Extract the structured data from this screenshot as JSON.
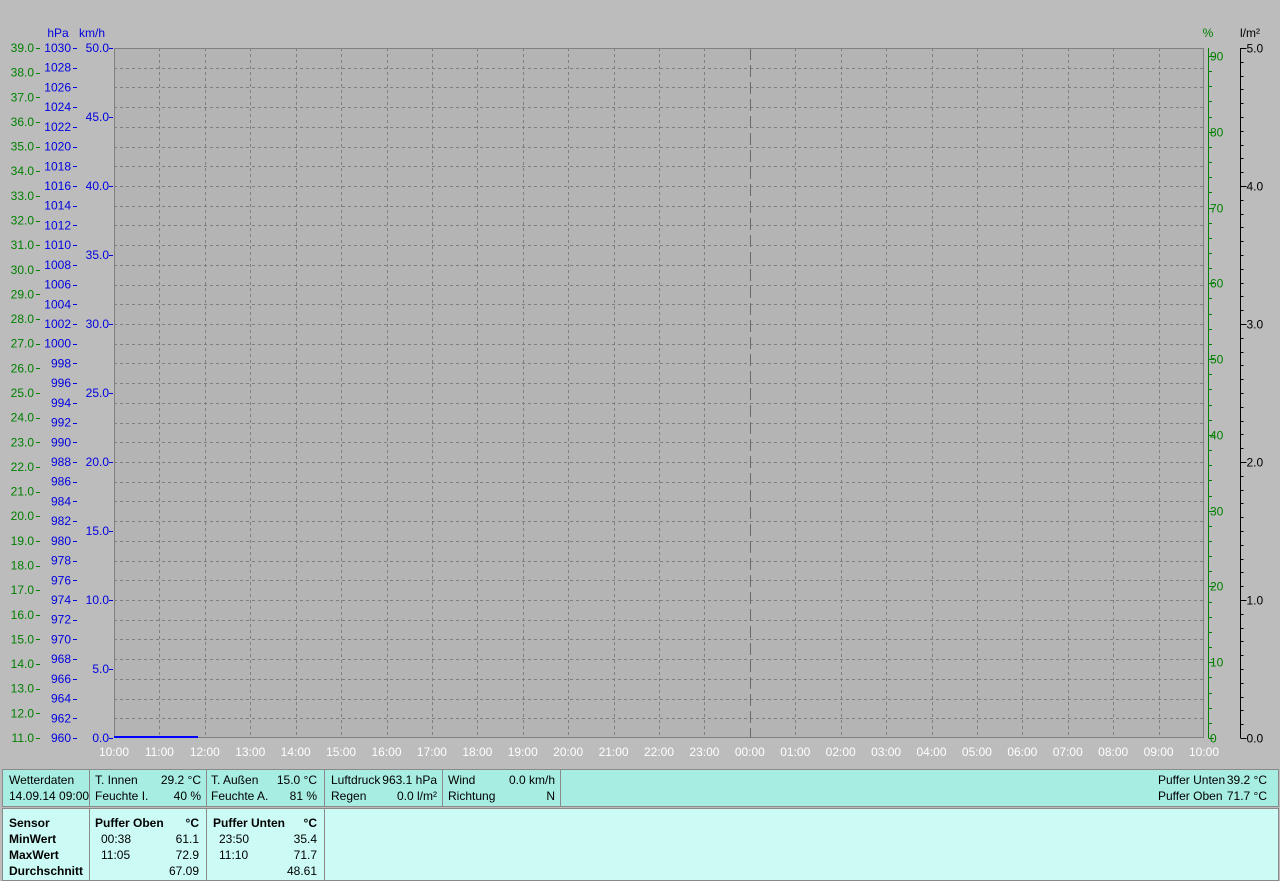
{
  "colors": {
    "background": "#bcbcbc",
    "plot_area": "#b4b4b4",
    "grid": "#7f7f7f",
    "axis_green": "#008000",
    "axis_blue": "#0000e0",
    "axis_black": "#000000",
    "status_bg": "#a8ede2",
    "table_bg": "#ccfbf6",
    "series_line": "#0000ff"
  },
  "chart_data": {
    "type": "line",
    "x_tick_labels": [
      "10:00",
      "11:00",
      "12:00",
      "13:00",
      "14:00",
      "15:00",
      "16:00",
      "17:00",
      "18:00",
      "19:00",
      "20:00",
      "21:00",
      "22:00",
      "23:00",
      "00:00",
      "01:00",
      "02:00",
      "03:00",
      "04:00",
      "05:00",
      "06:00",
      "07:00",
      "08:00",
      "09:00",
      "10:00"
    ],
    "midnight_tick_index": 14,
    "axes": {
      "temp": {
        "range": [
          11.0,
          39.0
        ],
        "step": 1.0,
        "color": "#008000",
        "label": ""
      },
      "pressure": {
        "range": [
          960,
          1030
        ],
        "step": 2,
        "color": "#0000e0",
        "label": "hPa"
      },
      "wind": {
        "range": [
          0.0,
          50.0
        ],
        "step": 5.0,
        "color": "#0000e0",
        "label": "km/h"
      },
      "humidity": {
        "range": [
          0,
          90
        ],
        "step": 10,
        "color": "#008000",
        "label": "%"
      },
      "rain": {
        "range": [
          0.0,
          5.0
        ],
        "step": 1.0,
        "color": "#000000",
        "label": "l/m²"
      }
    },
    "series": [
      {
        "axis": "wind",
        "color": "#0000ff",
        "x_hours": [
          0.0,
          1.85
        ],
        "values": [
          0.0,
          0.0
        ]
      }
    ],
    "grid": true
  },
  "status": {
    "wetterdaten_label": "Wetterdaten",
    "timestamp": "14.09.14 09:00",
    "t_innen_label": "T. Innen",
    "t_innen_value": "29.2 °C",
    "feuchte_i_label": "Feuchte I.",
    "feuchte_i_value": "40 %",
    "t_aussen_label": "T. Außen",
    "t_aussen_value": "15.0 °C",
    "feuchte_a_label": "Feuchte A.",
    "feuchte_a_value": "81 %",
    "luftdruck_label": "Luftdruck",
    "luftdruck_value": "963.1 hPa",
    "regen_label": "Regen",
    "regen_value": "0.0 l/m²",
    "wind_label": "Wind",
    "wind_value": "0.0 km/h",
    "richtung_label": "Richtung",
    "richtung_value": "N",
    "puffer_unten_label": "Puffer Unten",
    "puffer_unten_value": "39.2 °C",
    "puffer_oben_label": "Puffer Oben",
    "puffer_oben_value": "71.7 °C"
  },
  "table": {
    "sensor_header": "Sensor",
    "rows": [
      "MinWert",
      "MaxWert",
      "Durchschnitt"
    ],
    "col1": {
      "header": "Puffer Oben",
      "unit": "°C",
      "min_time": "00:38",
      "min_value": "61.1",
      "max_time": "11:05",
      "max_value": "72.9",
      "avg_value": "67.09"
    },
    "col2": {
      "header": "Puffer Unten",
      "unit": "°C",
      "min_time": "23:50",
      "min_value": "35.4",
      "max_time": "11:10",
      "max_value": "71.7",
      "avg_value": "48.61"
    }
  }
}
